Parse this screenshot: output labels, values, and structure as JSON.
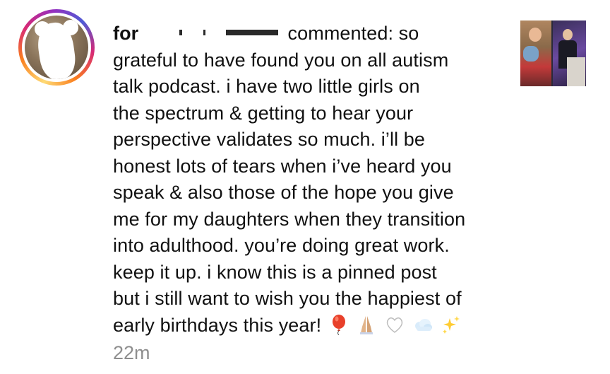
{
  "notification": {
    "username_visible": "for",
    "action_text": "commented: so",
    "comment_lines": [
      "grateful to have found you on all autism",
      "talk podcast. i have two little girls on",
      "the spectrum & getting to hear your",
      "perspective validates so much. i’ll be",
      "honest lots of tears when i’ve heard you",
      "speak & also those of the hope you give",
      "me for my daughters when they transition",
      "into adulthood. you’re doing great work.",
      "keep it up. i know this is a pinned post",
      "but i still want to wish you the happiest of",
      "early birthdays this year!"
    ],
    "emojis": [
      "🎈",
      "🙏",
      "🤍",
      "☁️",
      "✨"
    ],
    "timestamp": "22m"
  },
  "colors": {
    "text": "#111111",
    "timestamp": "#8e8e8e",
    "story_ring": [
      "#feda75",
      "#fa7e1e",
      "#d62976",
      "#962fbf"
    ]
  },
  "icons": {
    "avatar": "profile-avatar-with-story-ring",
    "thumbnail": "post-thumbnail"
  }
}
